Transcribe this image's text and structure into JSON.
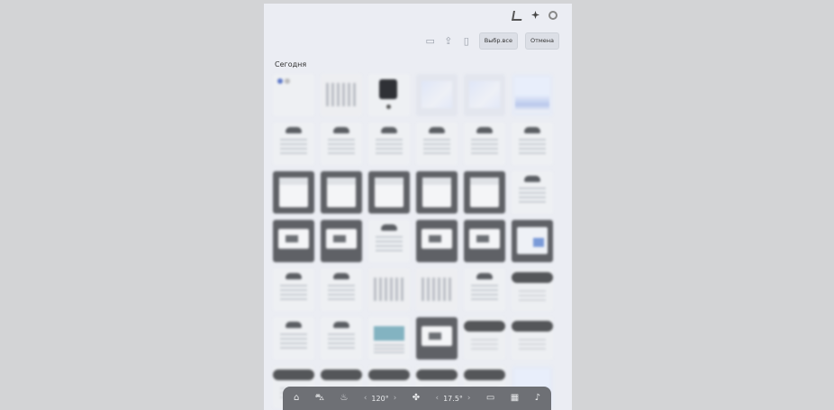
{
  "toolbar": {
    "select_all_label": "Выбр.все",
    "cancel_label": "Отмена",
    "folder_icon": "folder-icon",
    "share_icon": "share-icon",
    "delete_icon": "trash-icon"
  },
  "gallery": {
    "section_title": "Сегодня"
  },
  "dock": {
    "left_temp": "120°",
    "right_temp": "17.5°",
    "icons": [
      "home-icon",
      "car-icon",
      "seat-heat-icon",
      "fan-icon",
      "screen-icon",
      "apps-icon",
      "music-icon"
    ]
  }
}
